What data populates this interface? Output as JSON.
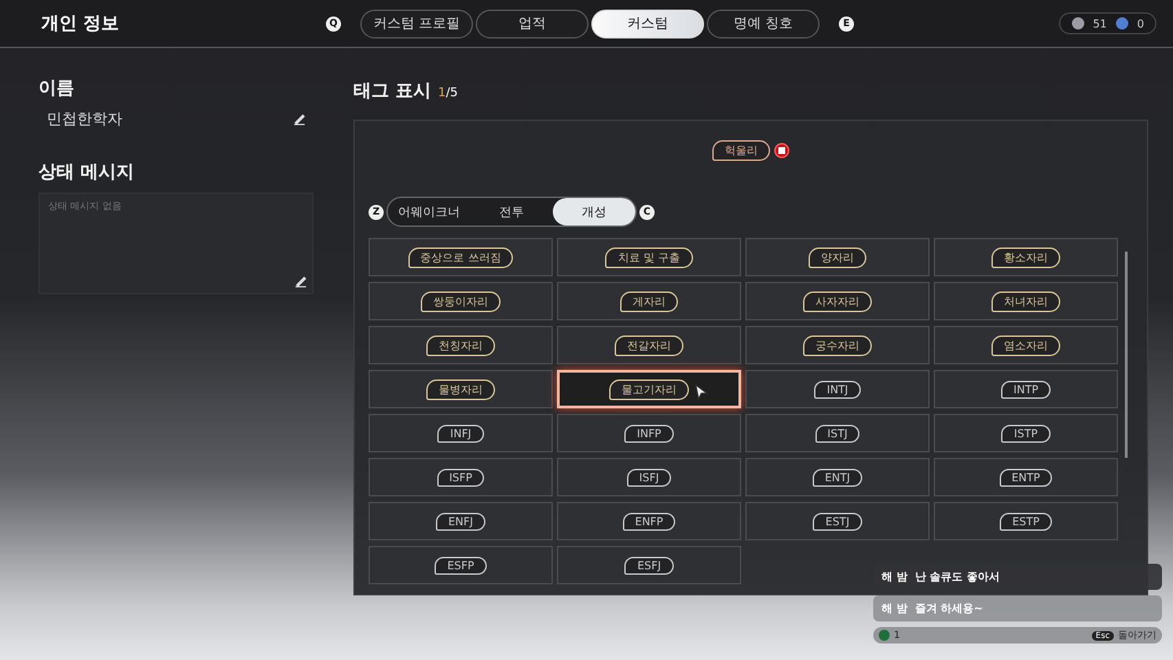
{
  "header": {
    "title": "개인 정보",
    "key_left": "Q",
    "key_right": "E",
    "tabs": [
      {
        "label": "커스텀 프로필",
        "selected": false
      },
      {
        "label": "업적",
        "selected": false
      },
      {
        "label": "커스텀",
        "selected": true
      },
      {
        "label": "명예 칭호",
        "selected": false
      }
    ],
    "currencies": [
      "51",
      "0"
    ]
  },
  "profile": {
    "name_label": "이름",
    "name": "민첩한학자",
    "status_label": "상태 메시지",
    "status_placeholder": "상태 메시지 없음"
  },
  "tags": {
    "title": "태그 표시",
    "count_current": "1",
    "count_max": "/5",
    "equipped": [
      {
        "label": "헉울리"
      }
    ],
    "key_left": "Z",
    "key_right": "C",
    "categories": [
      {
        "label": "어웨이크너",
        "selected": false
      },
      {
        "label": "전투",
        "selected": false
      },
      {
        "label": "개성",
        "selected": true
      }
    ],
    "items": [
      {
        "label": "중상으로 쓰러짐",
        "selected": false,
        "kind": "gold"
      },
      {
        "label": "치료 및 구출",
        "selected": false,
        "kind": "gold"
      },
      {
        "label": "양자리",
        "selected": false,
        "kind": "gold"
      },
      {
        "label": "황소자리",
        "selected": false,
        "kind": "gold"
      },
      {
        "label": "쌍둥이자리",
        "selected": false,
        "kind": "gold"
      },
      {
        "label": "게자리",
        "selected": false,
        "kind": "gold"
      },
      {
        "label": "사자자리",
        "selected": false,
        "kind": "gold"
      },
      {
        "label": "처녀자리",
        "selected": false,
        "kind": "gold"
      },
      {
        "label": "천칭자리",
        "selected": false,
        "kind": "gold"
      },
      {
        "label": "전갈자리",
        "selected": false,
        "kind": "gold"
      },
      {
        "label": "궁수자리",
        "selected": false,
        "kind": "gold"
      },
      {
        "label": "염소자리",
        "selected": false,
        "kind": "gold"
      },
      {
        "label": "물병자리",
        "selected": false,
        "kind": "gold"
      },
      {
        "label": "물고기자리",
        "selected": true,
        "kind": "gold"
      },
      {
        "label": "INTJ",
        "selected": false,
        "kind": "plain"
      },
      {
        "label": "INTP",
        "selected": false,
        "kind": "plain"
      },
      {
        "label": "INFJ",
        "selected": false,
        "kind": "plain"
      },
      {
        "label": "INFP",
        "selected": false,
        "kind": "plain"
      },
      {
        "label": "ISTJ",
        "selected": false,
        "kind": "plain"
      },
      {
        "label": "ISTP",
        "selected": false,
        "kind": "plain"
      },
      {
        "label": "ISFP",
        "selected": false,
        "kind": "plain"
      },
      {
        "label": "ISFJ",
        "selected": false,
        "kind": "plain"
      },
      {
        "label": "ENTJ",
        "selected": false,
        "kind": "plain"
      },
      {
        "label": "ENTP",
        "selected": false,
        "kind": "plain"
      },
      {
        "label": "ENFJ",
        "selected": false,
        "kind": "plain"
      },
      {
        "label": "ENFP",
        "selected": false,
        "kind": "plain"
      },
      {
        "label": "ESTJ",
        "selected": false,
        "kind": "plain"
      },
      {
        "label": "ESTP",
        "selected": false,
        "kind": "plain"
      },
      {
        "label": "ESFP",
        "selected": false,
        "kind": "plain"
      },
      {
        "label": "ESFJ",
        "selected": false,
        "kind": "plain"
      }
    ]
  },
  "chat": {
    "messages": [
      {
        "name": "해 밤",
        "text": "난 솔큐도 좋아서",
        "highlighted": true
      },
      {
        "name": "해 밤",
        "text": "즐겨 하세용~",
        "highlighted": false
      }
    ],
    "count": "1",
    "key": "Esc",
    "action": "돌아가기"
  }
}
